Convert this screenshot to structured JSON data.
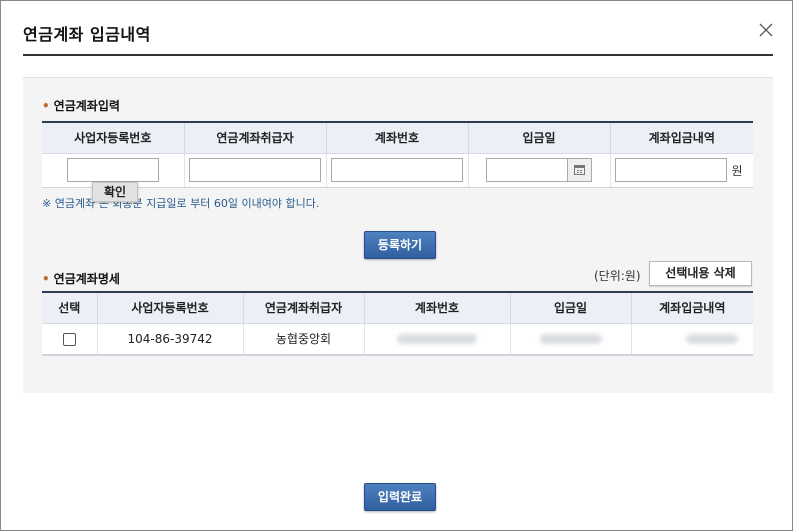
{
  "dialog": {
    "title": "연금계좌 입금내역"
  },
  "input_section": {
    "title": "연금계좌입력",
    "columns": [
      "사업자등록번호",
      "연금계좌취급자",
      "계좌번호",
      "입금일",
      "계좌입금내역"
    ],
    "won_unit": "원",
    "confirm_label": "확인",
    "notice": "※ 연금계좌  은 회종분 지급일로 부터 60일 이내여야 합니다.",
    "register_label": "등록하기"
  },
  "list_section": {
    "title": "연금계좌명세",
    "unit_text": "(단위:원)",
    "delete_label": "선택내용 삭제",
    "columns": [
      "선택",
      "사업자등록번호",
      "연금계좌취급자",
      "계좌번호",
      "입금일",
      "계좌입금내역"
    ],
    "rows": [
      {
        "business_number": "104-86-39742",
        "handler": "농협중앙회"
      }
    ]
  },
  "footer": {
    "complete_label": "입력완료"
  },
  "icons": {
    "close": "close-icon",
    "calendar": "calendar-icon"
  },
  "colors": {
    "header_bg": "#ecf0f6",
    "header_border": "#2f3b54",
    "button_blue": "#2f5f9e",
    "notice_text": "#2a5c8f"
  }
}
